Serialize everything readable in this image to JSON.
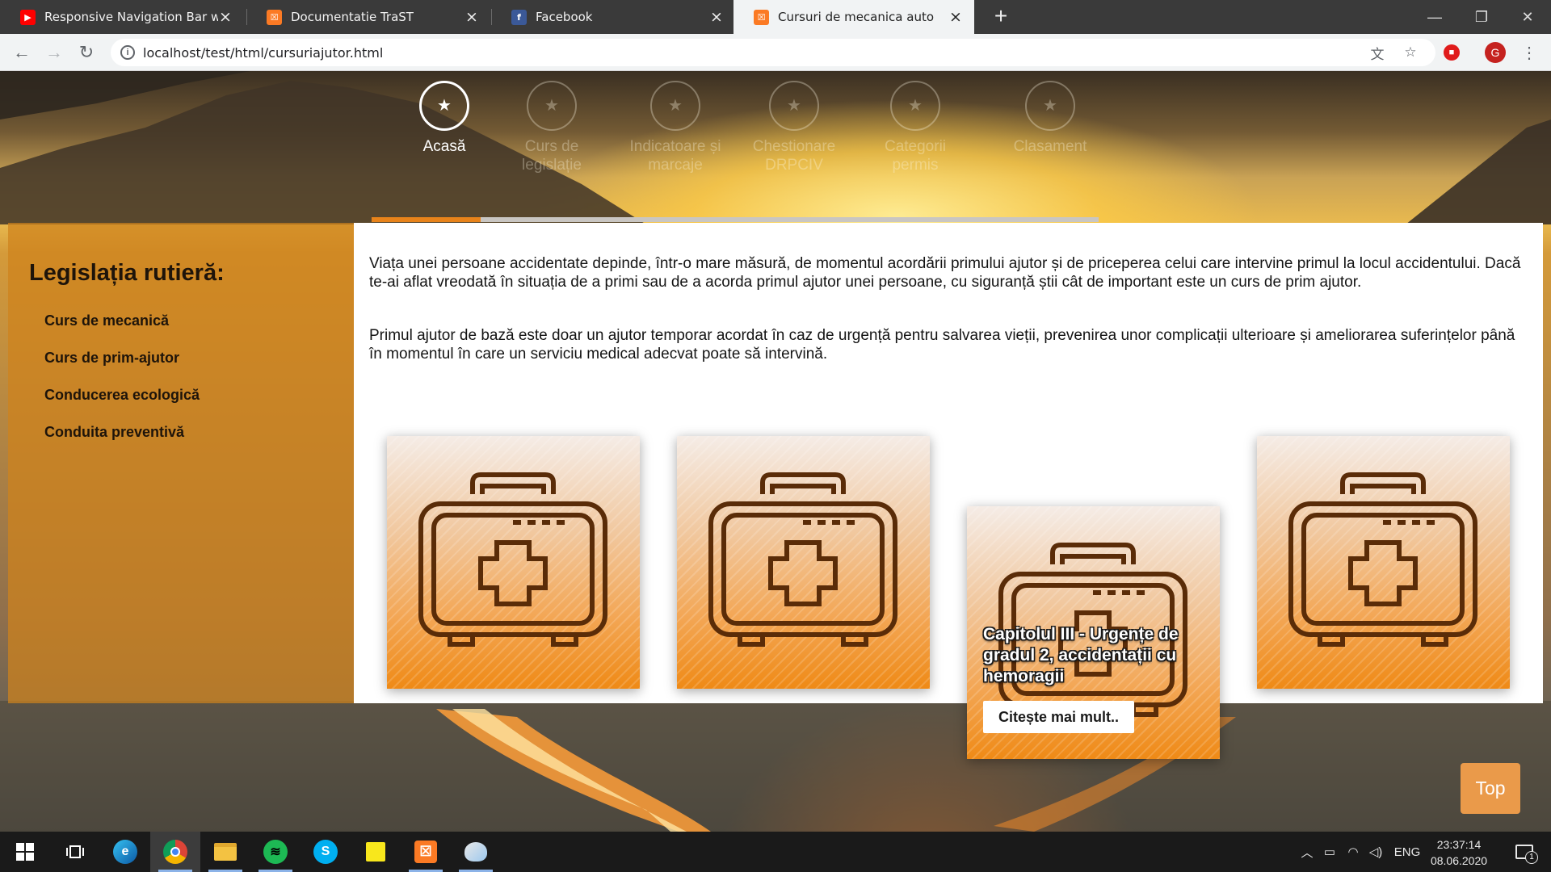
{
  "browser": {
    "tabs": [
      {
        "title": "Responsive Navigation Bar with H",
        "favicon": "youtube-icon",
        "active": false
      },
      {
        "title": "Documentatie TraST",
        "favicon": "xampp-icon",
        "active": false
      },
      {
        "title": "Facebook",
        "favicon": "facebook-icon",
        "active": false
      },
      {
        "title": "Cursuri de mecanica auto",
        "favicon": "xampp-icon",
        "active": true
      }
    ],
    "url": "localhost/test/html/cursuriajutor.html",
    "profile_initial": "G"
  },
  "nav": {
    "items": [
      {
        "label": "Acasă",
        "icon": "star-icon",
        "active": true
      },
      {
        "label": "Curs de legislație",
        "icon": "star-icon",
        "active": false
      },
      {
        "label": "Indicatoare și marcaje",
        "icon": "star-icon",
        "active": false
      },
      {
        "label": "Chestionare DRPCIV",
        "icon": "star-icon",
        "active": false
      },
      {
        "label": "Categorii permis",
        "icon": "star-icon",
        "active": false
      },
      {
        "label": "Clasament",
        "icon": "star-icon",
        "active": false
      }
    ],
    "slider_progress": 0.15
  },
  "sidebar": {
    "title": "Legislația rutieră:",
    "links": [
      "Curs de mecanică",
      "Curs de prim-ajutor",
      "Conducerea ecologică",
      "Conduita preventivă"
    ]
  },
  "content": {
    "paragraphs": [
      "Viața unei persoane accidentate depinde, într-o mare măsură, de momentul acordării primului ajutor și de priceperea celui care intervine primul la locul accidentului. Dacă te-ai aflat vreodată în situația de a primi sau de a acorda primul ajutor unei persoane, cu siguranță știi cât de important este un curs de prim ajutor.",
      "Primul ajutor de bază este doar un ajutor temporar acordat în caz de urgență pentru salvarea vieții, prevenirea unor complicații ulterioare și ameliorarea suferințelor până în momentul în care un serviciu medical adecvat poate să intervină."
    ],
    "cards": [
      {
        "icon": "first-aid-kit-icon"
      },
      {
        "icon": "first-aid-kit-icon"
      },
      {
        "icon": "first-aid-kit-icon",
        "hovered": true,
        "title": "Capitolul III - Urgențe de gradul 2, accidentații cu hemoragii",
        "button": "Citește mai mult.."
      },
      {
        "icon": "first-aid-kit-icon"
      }
    ]
  },
  "top_button": "Top",
  "taskbar": {
    "apps": [
      "start-icon",
      "task-view-icon",
      "edge-icon",
      "chrome-icon",
      "file-explorer-icon",
      "spotify-icon",
      "skype-icon",
      "sticky-notes-icon",
      "xampp-icon",
      "paint-icon"
    ],
    "language": "ENG",
    "time": "23:37:14",
    "date": "08.06.2020",
    "notification_count": "1"
  }
}
